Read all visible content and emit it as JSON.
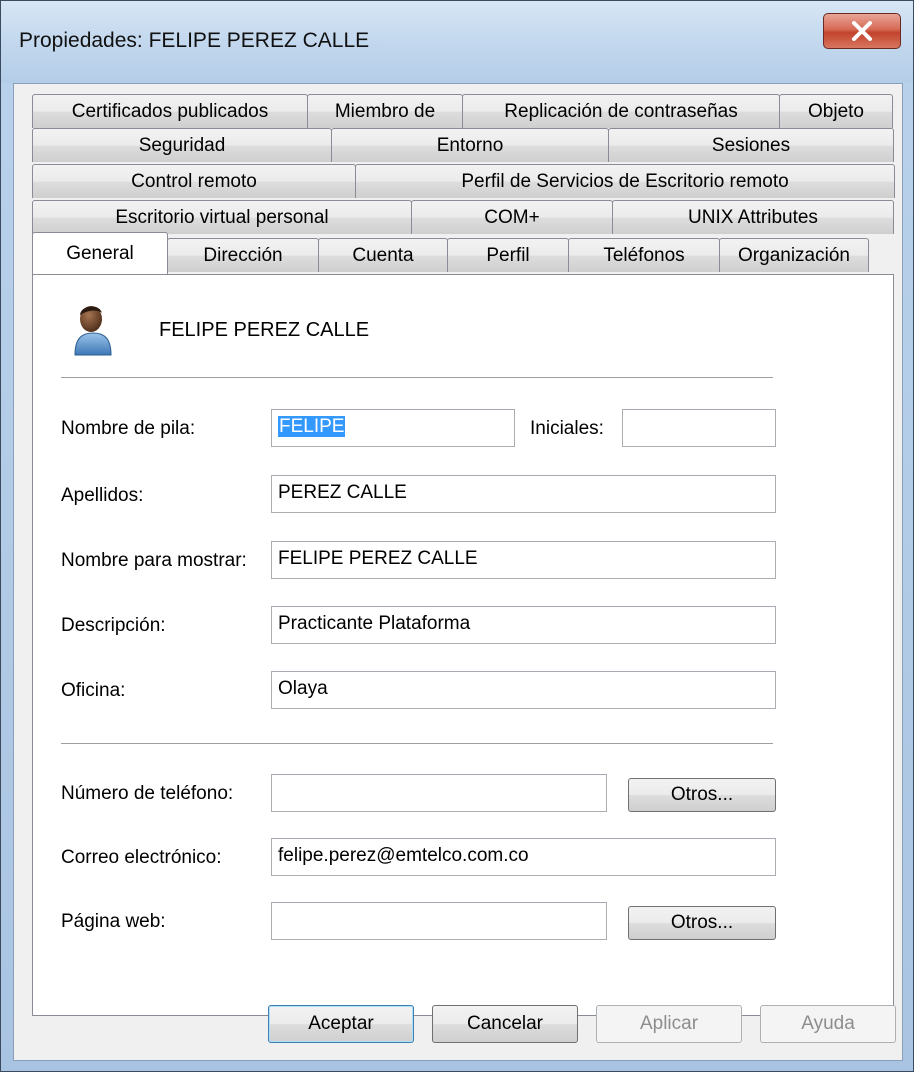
{
  "window": {
    "title": "Propiedades: FELIPE PEREZ CALLE",
    "close_label": "X"
  },
  "tabs": {
    "row1": [
      "Certificados publicados",
      "Miembro de",
      "Replicación de contraseñas",
      "Objeto"
    ],
    "row2": [
      "Seguridad",
      "Entorno",
      "Sesiones"
    ],
    "row3": [
      "Control remoto",
      "Perfil de Servicios de Escritorio remoto"
    ],
    "row4": [
      "Escritorio virtual personal",
      "COM+",
      "UNIX Attributes"
    ],
    "row5": [
      "General",
      "Dirección",
      "Cuenta",
      "Perfil",
      "Teléfonos",
      "Organización"
    ],
    "active": "General"
  },
  "general": {
    "display_heading": "FELIPE PEREZ CALLE",
    "avatar_icon": "user-icon",
    "fields": {
      "first_name": {
        "label": "Nombre de pila:",
        "value": "FELIPE"
      },
      "initials": {
        "label": "Iniciales:",
        "value": ""
      },
      "last_name": {
        "label": "Apellidos:",
        "value": "PEREZ CALLE"
      },
      "display_name": {
        "label": "Nombre para mostrar:",
        "value": "FELIPE PEREZ CALLE"
      },
      "description": {
        "label": "Descripción:",
        "value": "Practicante Plataforma"
      },
      "office": {
        "label": "Oficina:",
        "value": "Olaya"
      },
      "phone": {
        "label": "Número de teléfono:",
        "value": ""
      },
      "email": {
        "label": "Correo electrónico:",
        "value": "felipe.perez@emtelco.com.co"
      },
      "web_page": {
        "label": "Página web:",
        "value": ""
      }
    },
    "other_button": "Otros..."
  },
  "buttons": {
    "ok": "Aceptar",
    "cancel": "Cancelar",
    "apply": "Aplicar",
    "help": "Ayuda"
  }
}
